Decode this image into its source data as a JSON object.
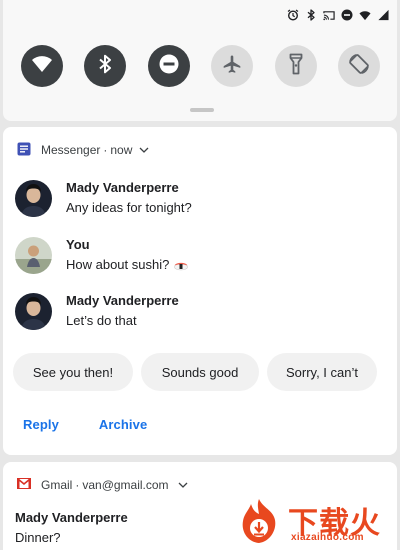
{
  "status_bar": {
    "icons": [
      "alarm-icon",
      "bluetooth-icon",
      "cast-icon",
      "do-not-disturb-icon",
      "wifi-icon",
      "battery-icon"
    ]
  },
  "quick_settings": {
    "tiles": [
      {
        "name": "wifi",
        "icon": "wifi-icon",
        "active": true
      },
      {
        "name": "bluetooth",
        "icon": "bluetooth-icon",
        "active": true
      },
      {
        "name": "do-not-disturb",
        "icon": "do-not-disturb-icon",
        "active": true
      },
      {
        "name": "airplane-mode",
        "icon": "airplane-icon",
        "active": false
      },
      {
        "name": "flashlight",
        "icon": "flashlight-icon",
        "active": false
      },
      {
        "name": "auto-rotate",
        "icon": "rotate-icon",
        "active": false
      }
    ]
  },
  "messenger": {
    "app_name": "Messenger",
    "time": "now",
    "icon_color": "#3f51b5",
    "messages": [
      {
        "sender": "Mady Vanderperre",
        "text": "Any ideas for tonight?"
      },
      {
        "sender": "You",
        "text": "How about sushi?",
        "emoji": "sushi-icon"
      },
      {
        "sender": "Mady Vanderperre",
        "text": "Let’s do that"
      }
    ],
    "smart_replies": [
      "See you then!",
      "Sounds good",
      "Sorry, I can’t"
    ],
    "actions": [
      "Reply",
      "Archive"
    ],
    "accent_color": "#1a73e8"
  },
  "gmail": {
    "app_name": "Gmail",
    "account": "van@gmail.com",
    "sender": "Mady Vanderperre",
    "subject": "Dinner?",
    "icon_color": "#d93025"
  },
  "watermark": {
    "text": "下载火",
    "subtext": "xiazaihuo.com",
    "color": "#e8481f"
  }
}
